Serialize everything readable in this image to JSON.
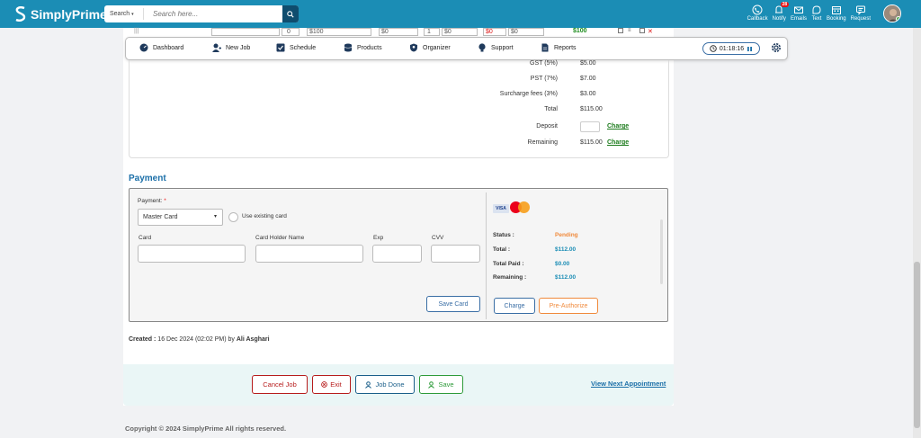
{
  "brand": {
    "name": "SimplyPrime",
    "accent": "#1b8db5"
  },
  "search": {
    "type_label": "Search",
    "placeholder": "Search here..."
  },
  "toolbar": {
    "items": [
      {
        "label": "Callback",
        "icon": "phone-icon"
      },
      {
        "label": "Notify",
        "icon": "bell-icon",
        "badge": "28"
      },
      {
        "label": "Emails",
        "icon": "mail-icon"
      },
      {
        "label": "Text",
        "icon": "chat-icon"
      },
      {
        "label": "Booking",
        "icon": "calendar-icon"
      },
      {
        "label": "Request",
        "icon": "request-icon"
      }
    ]
  },
  "ghost_row": {
    "c1": "0",
    "c2": "$100",
    "c3": "$0",
    "c4": "1",
    "c5": "$0",
    "c6": "$0",
    "c7": "$0",
    "c8": "$100"
  },
  "nav": {
    "items": [
      {
        "label": "Dashboard",
        "icon": "dashboard-icon"
      },
      {
        "label": "New Job",
        "icon": "new-job-icon"
      },
      {
        "label": "Schedule",
        "icon": "schedule-icon"
      },
      {
        "label": "Products",
        "icon": "products-icon"
      },
      {
        "label": "Organizer",
        "icon": "organizer-icon"
      },
      {
        "label": "Support",
        "icon": "support-icon"
      },
      {
        "label": "Reports",
        "icon": "reports-icon"
      }
    ],
    "timer": "01:18:16"
  },
  "totals": {
    "gst_label": "GST (5%)",
    "gst": "$5.00",
    "pst_label": "PST (7%)",
    "pst": "$7.00",
    "surcharge_label": "Surcharge fees (3%)",
    "surcharge": "$3.00",
    "total_label": "Total",
    "total": "$115.00",
    "deposit_label": "Deposit",
    "deposit_value": "",
    "remaining_label": "Remaining",
    "remaining": "$115.00",
    "charge_label": "Charge"
  },
  "payment": {
    "title": "Payment",
    "method_label": "Payment:",
    "method_value": "Master Card",
    "use_existing_label": "Use existing card",
    "card_label": "Card",
    "holder_label": "Card Holder Name",
    "exp_label": "Exp",
    "cvv_label": "CVV",
    "save_card_label": "Save Card",
    "visa_label": "VISA",
    "status_label": "Status :",
    "status": "Pending",
    "total_label": "Total :",
    "total": "$112.00",
    "paid_label": "Total Paid :",
    "paid": "$0.00",
    "remaining_label": "Remaining :",
    "remaining": "$112.00",
    "charge_label": "Charge",
    "preauth_label": "Pre-Authorize",
    "status_color": "#f08a3c",
    "value_color": "#1b8db5"
  },
  "created": {
    "prefix": "Created :",
    "date": "16 Dec 2024 (02:02 PM)",
    "by": "by",
    "user": "Ali Asghari"
  },
  "actions": {
    "cancel": "Cancel Job",
    "exit": "Exit",
    "done": "Job Done",
    "save": "Save",
    "view_next": "View Next Appointment"
  },
  "footer": {
    "copyright": "Copyright © 2024 SimplyPrime All rights reserved."
  }
}
